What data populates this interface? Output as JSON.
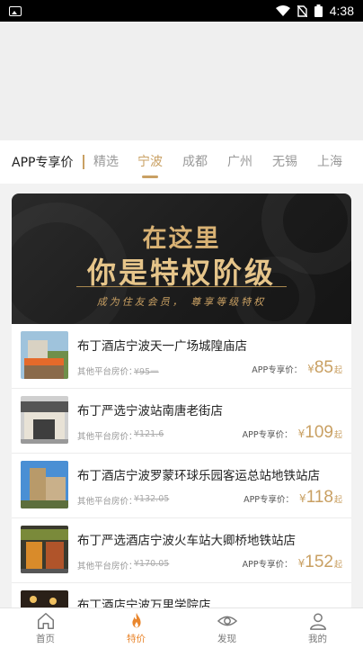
{
  "status_bar": {
    "time": "4:38"
  },
  "tabs": {
    "title": "APP专享价",
    "items": [
      {
        "label": "精选",
        "active": false
      },
      {
        "label": "宁波",
        "active": true
      },
      {
        "label": "成都",
        "active": false
      },
      {
        "label": "广州",
        "active": false
      },
      {
        "label": "无锡",
        "active": false
      },
      {
        "label": "上海",
        "active": false
      }
    ]
  },
  "banner": {
    "line1": "在这里",
    "line2": "你是特权阶级",
    "subtitle": "成为住友会员， 尊享等级特权"
  },
  "hotels": [
    {
      "name": "布丁酒店宁波天一广场城隍庙店",
      "other_label": "其他平台房价：",
      "other_price": "¥95一",
      "app_label": "APP专享价：",
      "currency": "¥",
      "price": "85",
      "suffix": "起"
    },
    {
      "name": "布丁严选宁波站南唐老街店",
      "other_label": "其他平台房价：",
      "other_price": "¥121.6",
      "app_label": "APP专享价：",
      "currency": "¥",
      "price": "109",
      "suffix": "起"
    },
    {
      "name": "布丁酒店宁波罗蒙环球乐园客运总站地铁站店",
      "other_label": "其他平台房价：",
      "other_price": "¥132.05",
      "app_label": "APP专享价：",
      "currency": "¥",
      "price": "118",
      "suffix": "起"
    },
    {
      "name": "布丁严选酒店宁波火车站大卿桥地铁站店",
      "other_label": "其他平台房价：",
      "other_price": "¥170.05",
      "app_label": "APP专享价：",
      "currency": "¥",
      "price": "152",
      "suffix": "起"
    },
    {
      "name": "布丁酒店宁波万里学院店",
      "other_label": "",
      "other_price": "",
      "app_label": "",
      "currency": "",
      "price": "",
      "suffix": ""
    }
  ],
  "bottom_nav": [
    {
      "label": "首页",
      "icon": "home-icon",
      "active": false
    },
    {
      "label": "特价",
      "icon": "flame-icon",
      "active": true
    },
    {
      "label": "发现",
      "icon": "eye-icon",
      "active": false
    },
    {
      "label": "我的",
      "icon": "user-icon",
      "active": false
    }
  ],
  "colors": {
    "accent": "#c9a063",
    "nav_active": "#e9862d",
    "banner_bg": "#1b1b1b"
  }
}
